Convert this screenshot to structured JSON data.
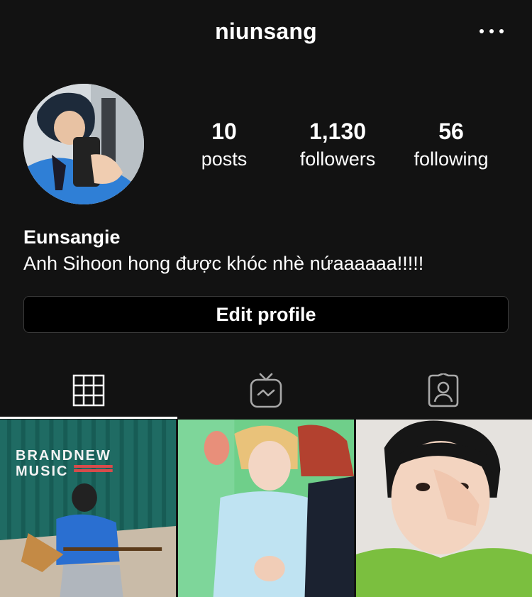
{
  "header": {
    "username": "niunsang",
    "more_icon": "more-horizontal-icon"
  },
  "profile": {
    "avatar_icon": "profile-photo",
    "stats": [
      {
        "value": "10",
        "label": "posts"
      },
      {
        "value": "1,130",
        "label": "followers"
      },
      {
        "value": "56",
        "label": "following"
      }
    ],
    "display_name": "Eunsangie",
    "bio": "Anh Sihoon hong được khóc nhè nứaaaaaa!!!!!",
    "edit_button_label": "Edit profile"
  },
  "tabs": [
    {
      "icon": "grid-icon",
      "active": true
    },
    {
      "icon": "igtv-icon",
      "active": false
    },
    {
      "icon": "tagged-icon",
      "active": false
    }
  ],
  "posts": [
    {
      "caption_line1": "BRANDNEW",
      "caption_line2": "MUSIC"
    },
    {},
    {}
  ],
  "colors": {
    "background": "#121212",
    "text": "#ffffff",
    "button_bg": "#000000",
    "button_border": "#3a3a3a"
  }
}
